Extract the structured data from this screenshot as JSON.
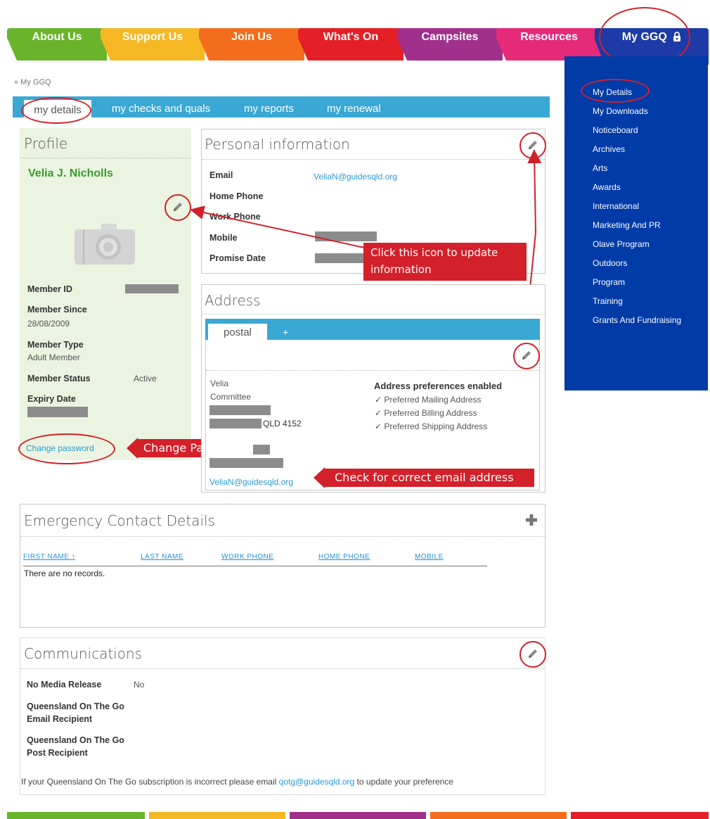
{
  "nav": {
    "tabs": [
      "About Us",
      "Support Us",
      "Join Us",
      "What's On",
      "Campsites",
      "Resources",
      "My GGQ"
    ],
    "colors": [
      "#69b42b",
      "#f5b824",
      "#f36d1d",
      "#e51f27",
      "#a0308c",
      "#e52a78",
      "#1d3aa6"
    ]
  },
  "breadcrumb": "» My GGQ",
  "subtabs": [
    "my details",
    "my checks and quals",
    "my reports",
    "my renewal"
  ],
  "profile": {
    "heading": "Profile",
    "name": "Velia J. Nicholls",
    "member_id_label": "Member ID",
    "member_since_label": "Member Since",
    "member_since": "28/08/2009",
    "member_type_label": "Member Type",
    "member_type": "Adult Member",
    "member_status_label": "Member Status",
    "member_status": "Active",
    "expiry_label": "Expiry Date",
    "change_password": "Change password"
  },
  "personal": {
    "heading": "Personal information",
    "email_label": "Email",
    "email": "VeliaN@guidesqld.org",
    "home_phone_label": "Home Phone",
    "work_phone_label": "Work Phone",
    "mobile_label": "Mobile",
    "promise_label": "Promise Date"
  },
  "address": {
    "heading": "Address",
    "tab": "postal",
    "add_tab": "+",
    "line1": "Velia",
    "line2": "Committee",
    "state": "QLD 4152",
    "email": "VeliaN@guidesqld.org",
    "prefs_title": "Address preferences enabled",
    "prefs": [
      "✓ Preferred Mailing Address",
      "✓ Preferred Billing Address",
      "✓ Preferred Shipping Address"
    ]
  },
  "callouts": {
    "update": "Click this icon to update information",
    "password": "Change Password",
    "email": "Check for correct email address"
  },
  "emergency": {
    "heading": "Emergency Contact Details",
    "columns": [
      "FIRST NAME ↑",
      "LAST NAME",
      "WORK PHONE",
      "HOME PHONE",
      "MOBILE"
    ],
    "empty": "There are no records."
  },
  "communications": {
    "heading": "Communications",
    "media_label": "No Media Release",
    "media_value": "No",
    "email_recipient": "Queensland On The Go Email Recipient",
    "post_recipient": "Queensland On The Go Post Recipient",
    "footer_pre": "If your Queensland On The Go subscription is incorrect please email ",
    "footer_email": "qotg@guidesqld.org",
    "footer_post": " to update your preference"
  },
  "sidebar": {
    "items": [
      "My Details",
      "My Downloads",
      "Noticeboard",
      "Archives",
      "Arts",
      "Awards",
      "International",
      "Marketing And PR",
      "Olave Program",
      "Outdoors",
      "Program",
      "Training",
      "Grants And Fundraising"
    ]
  },
  "icons": {
    "pencil": "pencil-icon",
    "camera": "camera-icon",
    "plus": "plus-icon",
    "lock": "lock-icon"
  }
}
